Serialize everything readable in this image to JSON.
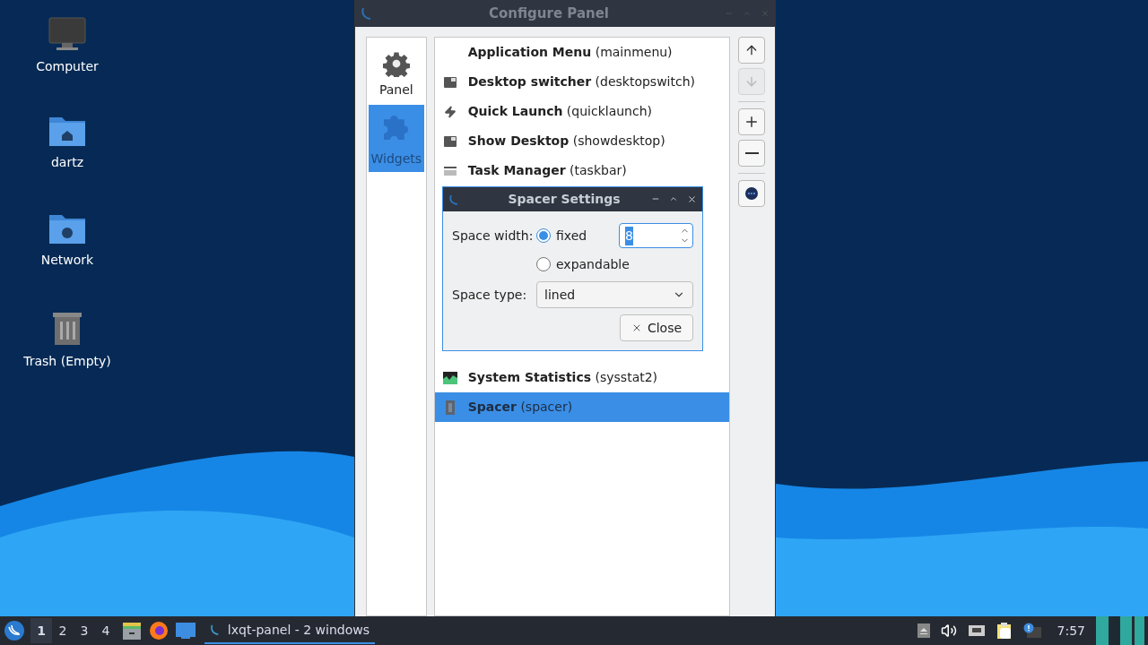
{
  "desktop_icons": [
    {
      "label": "Computer",
      "kind": "monitor"
    },
    {
      "label": "dartz",
      "kind": "home-folder"
    },
    {
      "label": "Network",
      "kind": "network-folder"
    },
    {
      "label": "Trash (Empty)",
      "kind": "trash"
    }
  ],
  "window": {
    "title": "Configure Panel",
    "sidebar": [
      {
        "label": "Panel",
        "kind": "gear",
        "selected": false
      },
      {
        "label": "Widgets",
        "kind": "puzzle",
        "selected": true
      }
    ],
    "widgets_top": [
      {
        "label": "**Application Menu** (mainmenu)",
        "kind": "none",
        "selected": false
      },
      {
        "label": "**Desktop switcher** (desktopswitch)",
        "kind": "window",
        "selected": false
      },
      {
        "label": "**Quick Launch** (quicklaunch)",
        "kind": "bolt",
        "selected": false
      },
      {
        "label": "**Show Desktop** (showdesktop)",
        "kind": "window",
        "selected": false
      },
      {
        "label": "**Task Manager** (taskbar)",
        "kind": "taskbar",
        "selected": false
      }
    ],
    "widgets_bottom": [
      {
        "label": "**System Statistics** (sysstat2)",
        "kind": "chart",
        "selected": false
      },
      {
        "label": "**Spacer** (spacer)",
        "kind": "spacer",
        "selected": true
      }
    ],
    "buttons": [
      {
        "kind": "up",
        "disabled": false
      },
      {
        "kind": "down",
        "disabled": true
      },
      {
        "kind": "add"
      },
      {
        "kind": "remove"
      },
      {
        "kind": "more"
      }
    ]
  },
  "dialog": {
    "title": "Spacer Settings",
    "width_label": "Space width:",
    "options": [
      {
        "label": "fixed",
        "selected": true
      },
      {
        "label": "expandable",
        "selected": false
      }
    ],
    "width_value": "8",
    "type_label": "Space type:",
    "type_value": "lined",
    "close": "Close"
  },
  "taskbar": {
    "desktops": [
      {
        "label": "1",
        "selected": true
      },
      {
        "label": "2",
        "selected": false
      },
      {
        "label": "3",
        "selected": false
      },
      {
        "label": "4",
        "selected": false
      }
    ],
    "task": {
      "label": "lxqt-panel - 2 windows",
      "selected": true
    },
    "clock": "7:57"
  }
}
